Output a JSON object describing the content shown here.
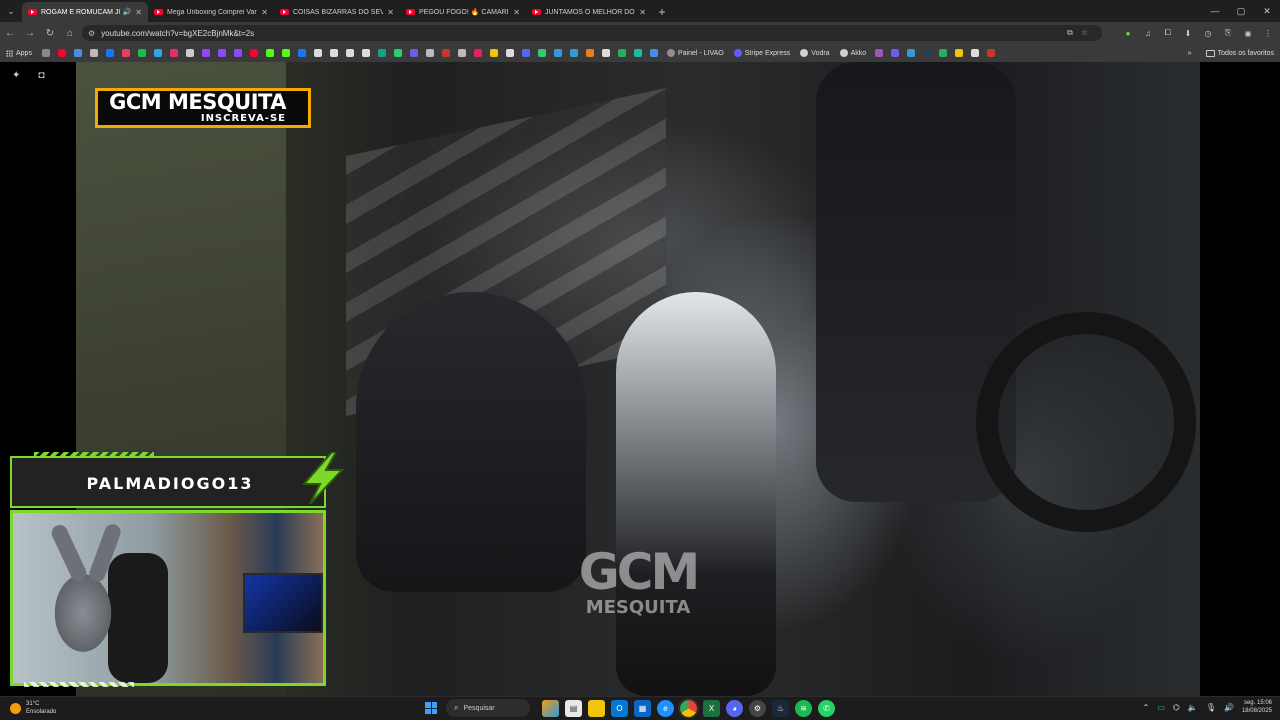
{
  "browser": {
    "tabs": [
      {
        "title": "ROGAM E ROMUCAM JUN",
        "active": true,
        "audio": true
      },
      {
        "title": "Mega Unboxing Comprei Vario",
        "active": false,
        "audio": false
      },
      {
        "title": "COISAS BIZARRAS DO SEVEN D",
        "active": false,
        "audio": false
      },
      {
        "title": "PEGOU FOGO! 🔥 CAMARIM D",
        "active": false,
        "audio": false
      },
      {
        "title": "JUNTAMOS O MELHOR DO BO",
        "active": false,
        "audio": false
      }
    ],
    "new_tab": "+",
    "url": "youtube.com/watch?v=bgXE2cBjnMk&t=2s",
    "bookmarks": {
      "apps_label": "Apps",
      "labeled": [
        {
          "label": "Painel - LIVAO",
          "color": "#8e8e8e"
        },
        {
          "label": "Stripe Express",
          "color": "#635bff"
        },
        {
          "label": "Vodra",
          "color": "#d0d0d0"
        },
        {
          "label": "Akko",
          "color": "#cfcfcf"
        }
      ],
      "end_label": "Todos os favoritos"
    }
  },
  "video": {
    "channel_logo": {
      "name": "GCM MESQUITA",
      "subtitle": "INSCREVA-SE"
    },
    "watermark": {
      "line1": "GCM",
      "line2": "MESQUITA"
    },
    "colors": {
      "logo_border": "#f5a800",
      "overlay_accent": "#7cd82a"
    }
  },
  "streamer_overlay": {
    "name": "PALMADIOGO13"
  },
  "taskbar": {
    "weather": {
      "temp": "31°C",
      "condition": "Ensolarado"
    },
    "search_placeholder": "Pesquisar",
    "clock": {
      "time": "15:06",
      "day": "seg.",
      "date": "18/08/2025"
    }
  }
}
